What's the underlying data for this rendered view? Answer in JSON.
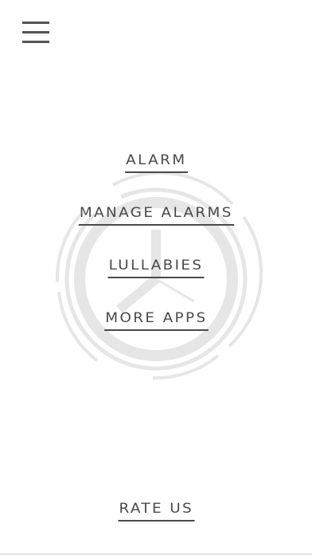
{
  "menu": {
    "icon": "hamburger-menu-icon"
  },
  "background": {
    "icon": "clock-icon",
    "color": "#e6e6e6"
  },
  "nav": {
    "alarm": "ALARM",
    "manage_alarms": "MANAGE ALARMS",
    "lullabies": "LULLABIES",
    "more_apps": "MORE APPS"
  },
  "footer": {
    "rate_us": "RATE US"
  },
  "colors": {
    "text": "#4a4a4a",
    "icon": "#555555",
    "background": "#ffffff"
  }
}
